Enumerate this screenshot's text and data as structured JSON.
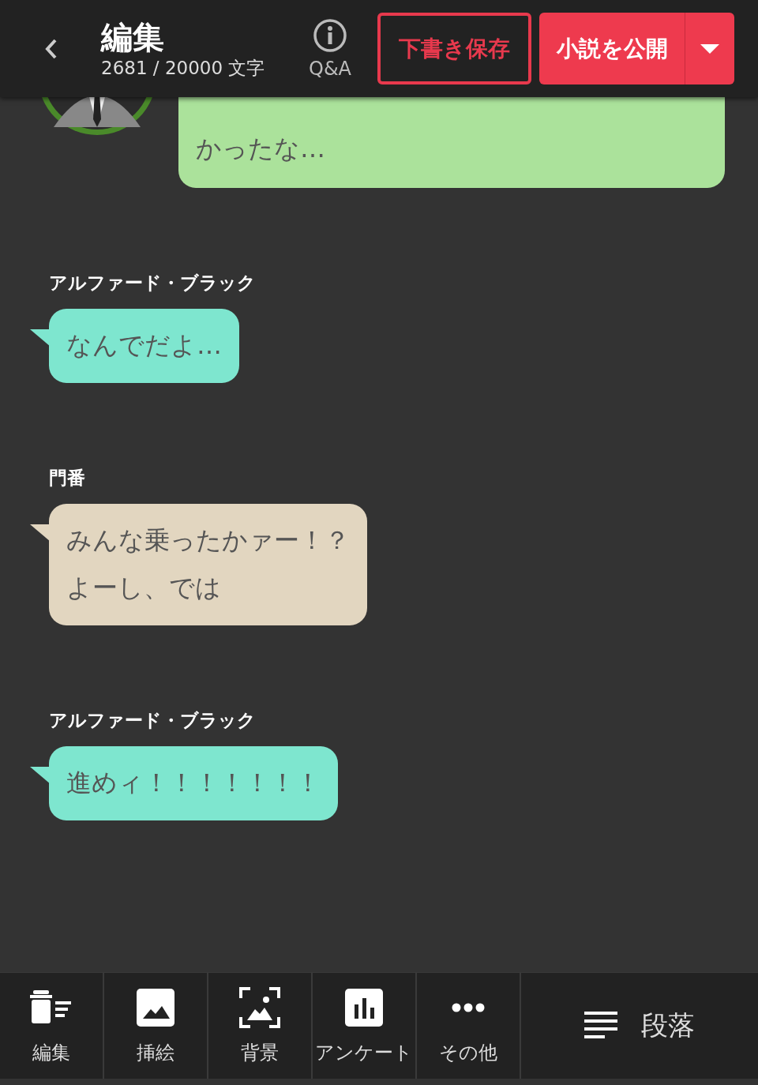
{
  "header": {
    "title": "編集",
    "count": "2681 / 20000 文字",
    "help_label": "Q&A",
    "draft_button": "下書き保存",
    "publish_button": "小説を公開"
  },
  "messages": [
    {
      "kind": "self",
      "color": "#abe29b",
      "lines": [
        "かったな…"
      ]
    },
    {
      "kind": "other",
      "speaker": "アルファード・ブラック",
      "color": "#7ee6cf",
      "lines": [
        "なんでだよ…"
      ]
    },
    {
      "kind": "other",
      "speaker": "門番",
      "color": "#e2d6c0",
      "lines": [
        "みんな乗ったかァー！？",
        "よーし、では"
      ]
    },
    {
      "kind": "other",
      "speaker": "アルファード・ブラック",
      "color": "#7ee6cf",
      "lines": [
        "進めィ！！！！！！！"
      ]
    }
  ],
  "toolbar": [
    {
      "kind": "edit",
      "label": "編集"
    },
    {
      "kind": "image",
      "label": "挿絵"
    },
    {
      "kind": "background",
      "label": "背景"
    },
    {
      "kind": "poll",
      "label": "アンケート"
    },
    {
      "kind": "more",
      "label": "その他"
    }
  ],
  "paragraph_button": "段落"
}
